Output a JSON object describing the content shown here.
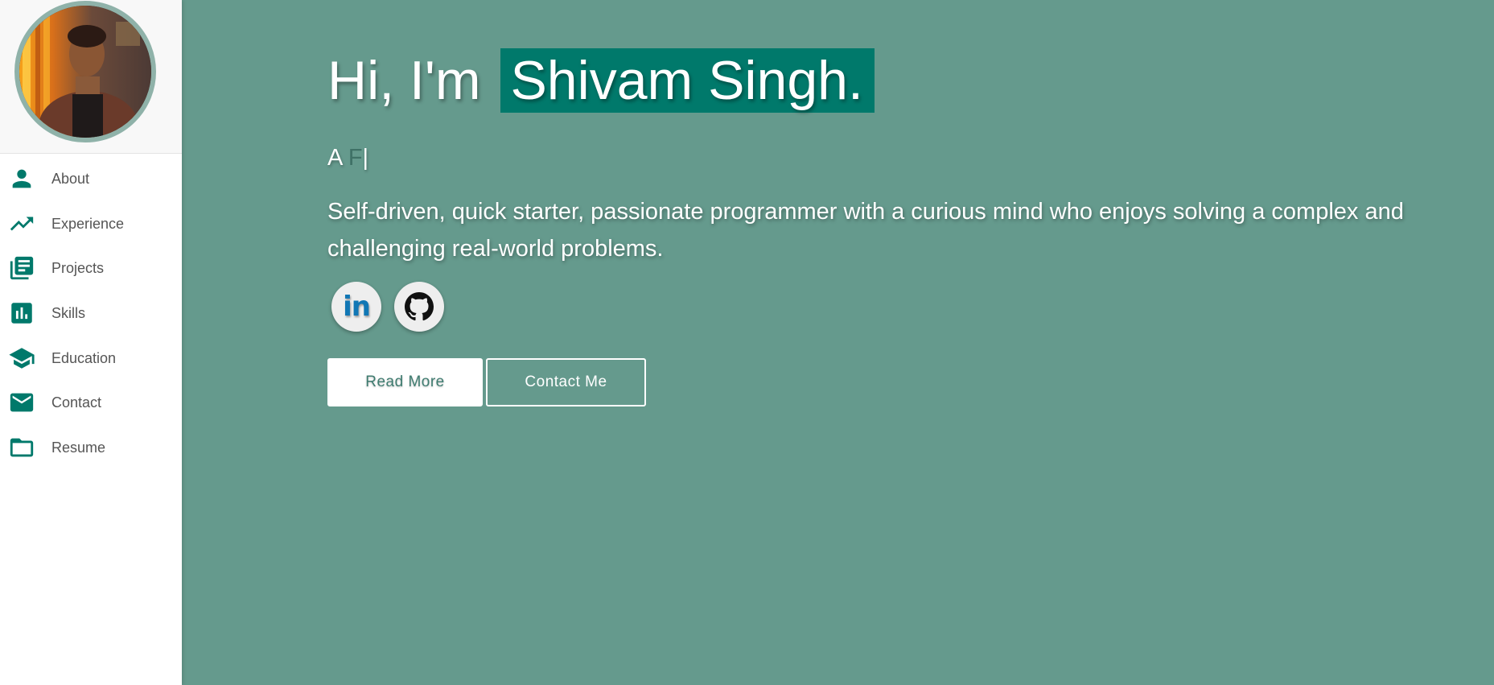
{
  "sidebar": {
    "items": [
      {
        "label": "About",
        "icon": "person-icon"
      },
      {
        "label": "Experience",
        "icon": "trending-up-icon"
      },
      {
        "label": "Projects",
        "icon": "library-books-icon"
      },
      {
        "label": "Skills",
        "icon": "bar-chart-icon"
      },
      {
        "label": "Education",
        "icon": "graduation-cap-icon"
      },
      {
        "label": "Contact",
        "icon": "mail-icon"
      },
      {
        "label": "Resume",
        "icon": "folder-icon"
      }
    ]
  },
  "hero": {
    "greeting": "Hi, I'm",
    "name": "Shivam Singh.",
    "typed_prefix": "A",
    "typed_text": "F",
    "cursor": "|",
    "bio": "Self-driven, quick starter, passionate programmer with a curious mind who enjoys solving a complex and challenging real-world problems.",
    "read_more_label": "Read More",
    "contact_label": "Contact Me",
    "social": [
      {
        "icon": "linkedin-icon",
        "text": "in"
      },
      {
        "icon": "github-icon"
      }
    ]
  },
  "colors": {
    "accent": "#00796b",
    "background": "#659a8d",
    "sidebar_bg": "#ffffff",
    "avatar_border": "#8fb2a9"
  }
}
